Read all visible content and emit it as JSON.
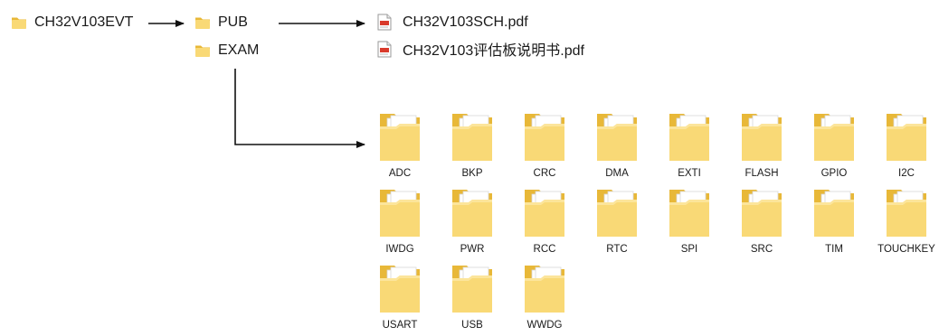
{
  "root": {
    "label": "CH32V103EVT",
    "icon": "folder-icon"
  },
  "level1": [
    {
      "label": "PUB",
      "icon": "folder-icon"
    },
    {
      "label": "EXAM",
      "icon": "folder-icon"
    }
  ],
  "pub_files": [
    {
      "label": "CH32V103SCH.pdf",
      "icon": "pdf-icon"
    },
    {
      "label": "CH32V103评估板说明书.pdf",
      "icon": "pdf-icon"
    }
  ],
  "exam_folders": [
    {
      "label": "ADC",
      "icon": "folder-with-documents-icon"
    },
    {
      "label": "BKP",
      "icon": "folder-with-documents-icon"
    },
    {
      "label": "CRC",
      "icon": "folder-with-documents-icon"
    },
    {
      "label": "DMA",
      "icon": "folder-with-documents-icon"
    },
    {
      "label": "EXTI",
      "icon": "folder-with-documents-icon"
    },
    {
      "label": "FLASH",
      "icon": "folder-with-documents-icon"
    },
    {
      "label": "GPIO",
      "icon": "folder-with-documents-icon"
    },
    {
      "label": "I2C",
      "icon": "folder-with-documents-icon"
    },
    {
      "label": "IWDG",
      "icon": "folder-with-documents-icon"
    },
    {
      "label": "PWR",
      "icon": "folder-with-documents-icon"
    },
    {
      "label": "RCC",
      "icon": "folder-with-documents-icon"
    },
    {
      "label": "RTC",
      "icon": "folder-with-documents-icon"
    },
    {
      "label": "SPI",
      "icon": "folder-with-documents-icon"
    },
    {
      "label": "SRC",
      "icon": "folder-with-documents-icon"
    },
    {
      "label": "TIM",
      "icon": "folder-with-documents-icon"
    },
    {
      "label": "TOUCHKEY",
      "icon": "folder-with-documents-icon"
    },
    {
      "label": "USART",
      "icon": "folder-with-documents-icon"
    },
    {
      "label": "USB",
      "icon": "folder-with-documents-icon"
    },
    {
      "label": "WWDG",
      "icon": "folder-with-documents-icon"
    }
  ],
  "colors": {
    "folder_back": "#E8B838",
    "folder_front": "#F9D976",
    "paper": "#FFFFFF",
    "arrow": "#111111",
    "pdf_red": "#D93A2B"
  }
}
